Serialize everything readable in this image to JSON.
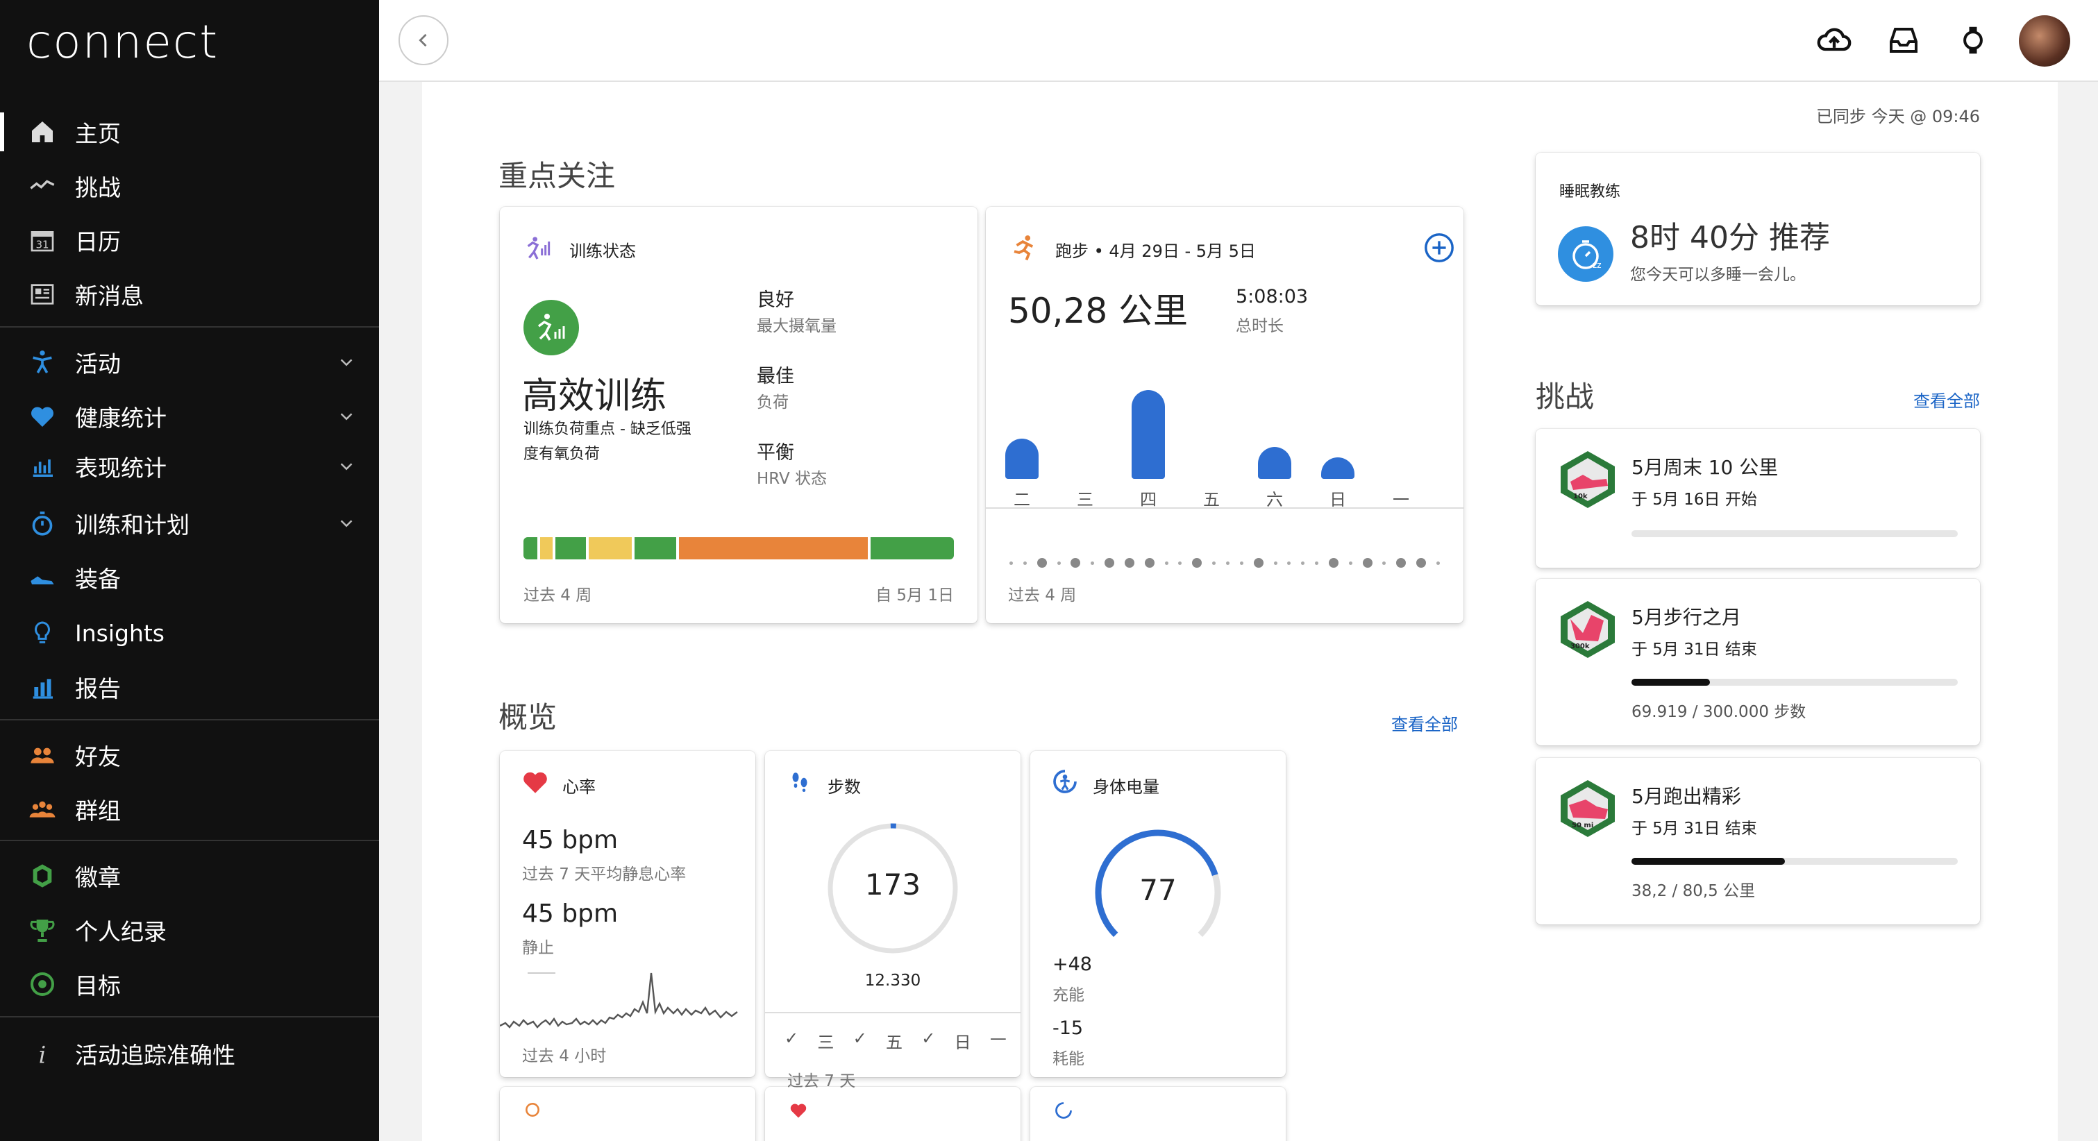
{
  "app": {
    "logo": "connect"
  },
  "sidebar": {
    "items": [
      {
        "label": "主页",
        "icon": "home-icon",
        "active": true
      },
      {
        "label": "挑战",
        "icon": "challenge-icon"
      },
      {
        "label": "日历",
        "icon": "calendar-icon",
        "badge": "31"
      },
      {
        "label": "新消息",
        "icon": "news-icon"
      },
      {
        "label": "活动",
        "icon": "activity-icon",
        "expandable": true
      },
      {
        "label": "健康统计",
        "icon": "heart-icon",
        "expandable": true
      },
      {
        "label": "表现统计",
        "icon": "performance-icon",
        "expandable": true
      },
      {
        "label": "训练和计划",
        "icon": "stopwatch-icon",
        "expandable": true
      },
      {
        "label": "装备",
        "icon": "shoe-icon"
      },
      {
        "label": "Insights",
        "icon": "lightbulb-icon"
      },
      {
        "label": "报告",
        "icon": "report-icon"
      },
      {
        "label": "好友",
        "icon": "friends-icon"
      },
      {
        "label": "群组",
        "icon": "groups-icon"
      },
      {
        "label": "徽章",
        "icon": "badge-icon"
      },
      {
        "label": "个人纪录",
        "icon": "trophy-icon"
      },
      {
        "label": "目标",
        "icon": "target-icon"
      },
      {
        "label": "活动追踪准确性",
        "icon": "info-icon"
      }
    ]
  },
  "topbar": {
    "icons": [
      "upload-cloud-icon",
      "inbox-icon",
      "watch-icon",
      "avatar"
    ]
  },
  "sync_status": "已同步 今天 @ 09:46",
  "focus": {
    "title": "重点关注",
    "training": {
      "header": "训练状态",
      "status": "高效训练",
      "desc": [
        "训练负荷重点 - 缺乏低强",
        "度有氧负荷"
      ],
      "metrics": [
        {
          "value": "良好",
          "label": "最大摄氧量"
        },
        {
          "value": "最佳",
          "label": "负荷"
        },
        {
          "value": "平衡",
          "label": "HRV 状态"
        }
      ],
      "footer_left": "过去 4 周",
      "footer_right": "自 5月 1日",
      "segments": [
        "#43a047",
        "#f0c95a",
        "#43a047",
        "#f0c95a",
        "#43a047",
        "#e8843a",
        "#43a047"
      ]
    },
    "running": {
      "header": "跑步 • 4月 29日 - 5月 5日",
      "distance": "50,28 公里",
      "duration": "5:08:03",
      "duration_label": "总时长",
      "days": [
        "二",
        "三",
        "四",
        "五",
        "六",
        "日",
        "一"
      ],
      "values_km": [
        6.3,
        0,
        14.0,
        0,
        5.0,
        3.4,
        0
      ],
      "footer": "过去 4 周",
      "color": "#2e6ed1"
    }
  },
  "sleep_coach": {
    "title": "睡眠教练",
    "value": "8时 40分 推荐",
    "desc": "您今天可以多睡一会儿。"
  },
  "challenges": {
    "title": "挑战",
    "view_all": "查看全部",
    "items": [
      {
        "name": "5月周末 10 公里",
        "sub": "于 5月 16日 开始",
        "progress": 0,
        "progress_text": ""
      },
      {
        "name": "5月步行之月",
        "sub": "于 5月 31日 结束",
        "progress": 0.233,
        "progress_text": "69.919 / 300.000 步数"
      },
      {
        "name": "5月跑出精彩",
        "sub": "于 5月 31日 结束",
        "progress": 0.474,
        "progress_text": "38,2 / 80,5 公里"
      }
    ]
  },
  "overview": {
    "title": "概览",
    "view_all": "查看全部",
    "heart": {
      "header": "心率",
      "avg_value": "45 bpm",
      "avg_label": "过去 7 天平均静息心率",
      "rest_value": "45 bpm",
      "rest_label": "静止",
      "footer": "过去 4 小时"
    },
    "steps": {
      "header": "步数",
      "value": "173",
      "goal": "12.330",
      "progress": 0.014,
      "week": [
        "✓",
        "三",
        "✓",
        "五",
        "✓",
        "日",
        "—"
      ],
      "footer": "过去 7 天"
    },
    "body_battery": {
      "header": "身体电量",
      "value": "77",
      "charged": "+48",
      "charged_label": "充能",
      "drained": "-15",
      "drained_label": "耗能",
      "level": 0.77
    }
  }
}
